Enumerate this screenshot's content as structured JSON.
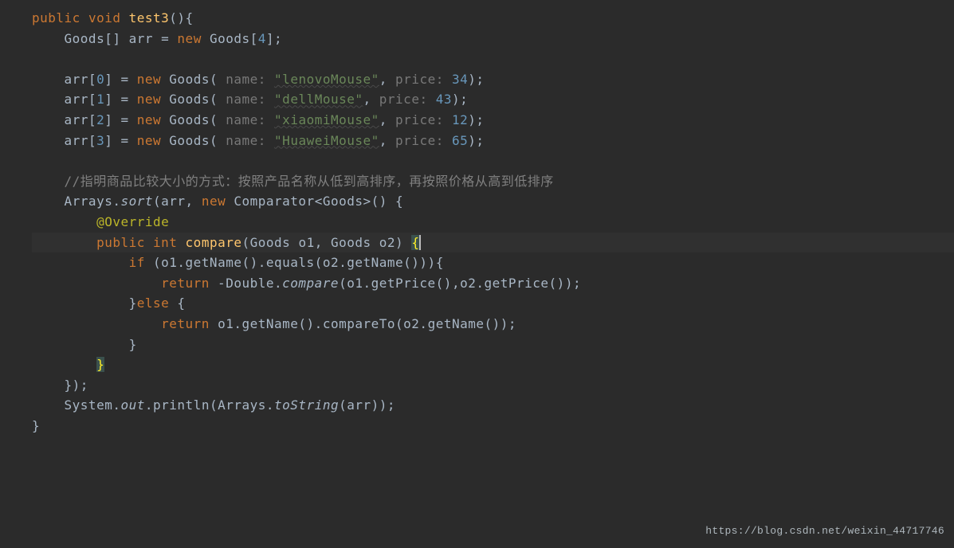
{
  "code": {
    "kw_public": "public",
    "kw_void": "void",
    "kw_new": "new",
    "kw_return": "return",
    "kw_if": "if",
    "kw_else": "else",
    "kw_int": "int",
    "method_name": "test3",
    "type_goods": "Goods",
    "arr": "arr",
    "array_size": "4",
    "idx0": "0",
    "idx1": "1",
    "idx2": "2",
    "idx3": "3",
    "hint_name": "name:",
    "hint_price": "price:",
    "str_lenovo": "\"lenovoMouse\"",
    "str_dell": "\"dellMouse\"",
    "str_xiaomi": "\"xiaomiMouse\"",
    "str_huawei": "\"HuaweiMouse\"",
    "price0": "34",
    "price1": "43",
    "price2": "12",
    "price3": "65",
    "comment_text": "//指明商品比较大小的方式：按照产品名称从低到高排序，再按照价格从高到低排序",
    "arrays": "Arrays",
    "sort": "sort",
    "comparator": "Comparator",
    "override": "@Override",
    "compare": "compare",
    "o1": "o1",
    "o2": "o2",
    "getName": "getName",
    "equals": "equals",
    "double": "Double",
    "compare_method": "compare",
    "getPrice": "getPrice",
    "compareTo": "compareTo",
    "system": "System",
    "out": "out",
    "println": "println",
    "toString": "toString"
  },
  "watermark": "https://blog.csdn.net/weixin_44717746"
}
